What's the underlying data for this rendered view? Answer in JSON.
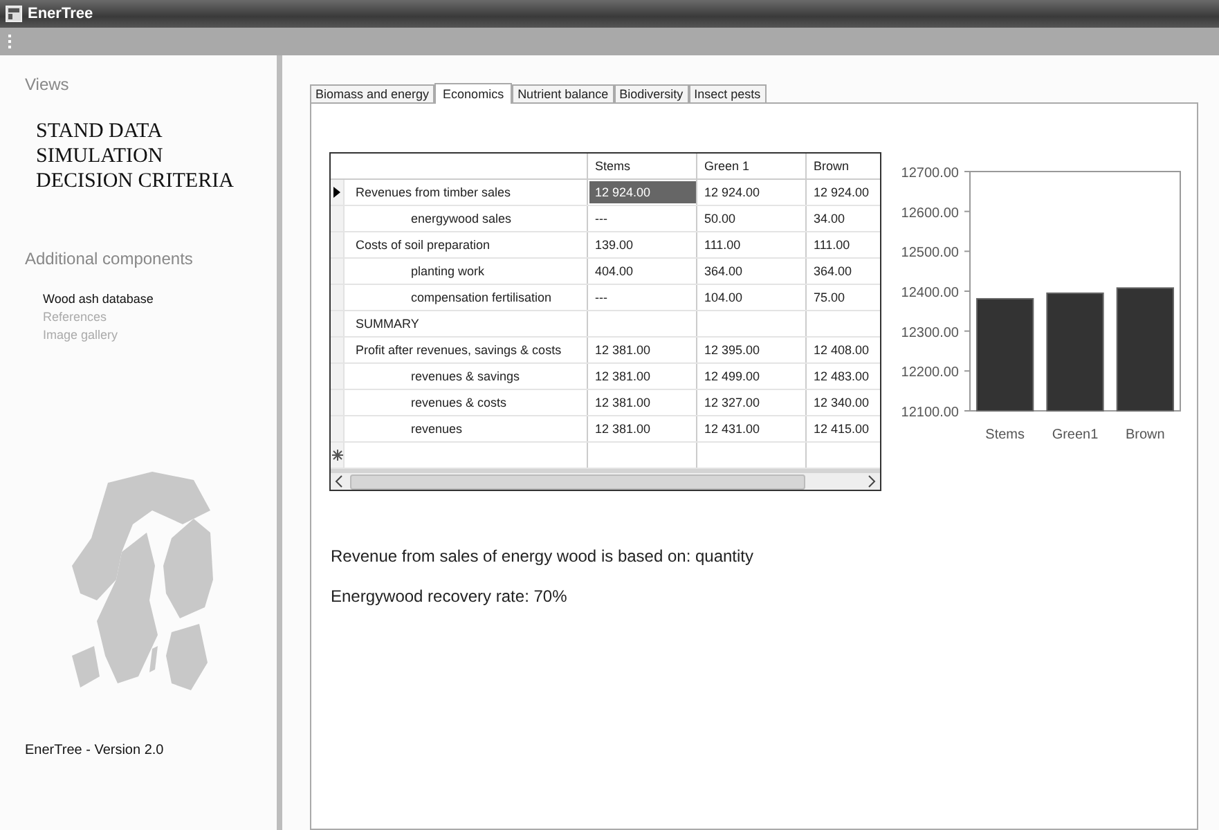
{
  "window": {
    "title": "EnerTree"
  },
  "sidebar": {
    "views_heading": "Views",
    "views": [
      "STAND DATA",
      "SIMULATION",
      "DECISION CRITERIA"
    ],
    "components_heading": "Additional components",
    "components": [
      {
        "label": "Wood ash database",
        "disabled": false
      },
      {
        "label": "References",
        "disabled": true
      },
      {
        "label": "Image gallery",
        "disabled": true
      }
    ],
    "version": "EnerTree - Version 2.0"
  },
  "tabs": [
    {
      "label": "Biomass and energy",
      "selected": false
    },
    {
      "label": "Economics",
      "selected": true
    },
    {
      "label": "Nutrient balance",
      "selected": false
    },
    {
      "label": "Biodiversity",
      "selected": false
    },
    {
      "label": "Insect pests",
      "selected": false
    }
  ],
  "table": {
    "columns": [
      "Stems",
      "Green 1",
      "Brown"
    ],
    "rows": [
      {
        "label": "Revenues from timber sales",
        "current": true,
        "cells": [
          {
            "text": "12 924.00",
            "selected": true
          },
          {
            "text": "12 924.00",
            "selected": false
          },
          {
            "text": "12 924.00",
            "selected": false
          }
        ],
        "children": [
          {
            "label": "energywood sales",
            "current": false,
            "cells": [
              {
                "text": "---",
                "selected": false
              },
              {
                "text": "50.00",
                "selected": false
              },
              {
                "text": "34.00",
                "selected": false
              }
            ]
          }
        ]
      },
      {
        "label": "Costs of soil preparation",
        "current": false,
        "cells": [
          {
            "text": "139.00",
            "selected": false
          },
          {
            "text": "111.00",
            "selected": false
          },
          {
            "text": "111.00",
            "selected": false
          }
        ],
        "children": [
          {
            "label": "planting work",
            "current": false,
            "cells": [
              {
                "text": "404.00",
                "selected": false
              },
              {
                "text": "364.00",
                "selected": false
              },
              {
                "text": "364.00",
                "selected": false
              }
            ]
          },
          {
            "label": "compensation fertilisation",
            "current": false,
            "cells": [
              {
                "text": "---",
                "selected": false
              },
              {
                "text": "104.00",
                "selected": false
              },
              {
                "text": "75.00",
                "selected": false
              }
            ]
          }
        ]
      },
      {
        "label": "SUMMARY",
        "current": false,
        "cells": []
      },
      {
        "label": "Profit after revenues, savings & costs",
        "current": false,
        "cells": [
          {
            "text": "12 381.00",
            "selected": false
          },
          {
            "text": "12 395.00",
            "selected": false
          },
          {
            "text": "12 408.00",
            "selected": false
          }
        ],
        "children": [
          {
            "label": "revenues & savings",
            "current": false,
            "cells": [
              {
                "text": "12 381.00",
                "selected": false
              },
              {
                "text": "12 499.00",
                "selected": false
              },
              {
                "text": "12 483.00",
                "selected": false
              }
            ]
          },
          {
            "label": "revenues & costs",
            "current": false,
            "cells": [
              {
                "text": "12 381.00",
                "selected": false
              },
              {
                "text": "12 327.00",
                "selected": false
              },
              {
                "text": "12 340.00",
                "selected": false
              }
            ]
          },
          {
            "label": "revenues",
            "current": false,
            "cells": [
              {
                "text": "12 381.00",
                "selected": false
              },
              {
                "text": "12 431.00",
                "selected": false
              },
              {
                "text": "12 415.00",
                "selected": false
              }
            ]
          }
        ]
      }
    ]
  },
  "chart": {
    "chart_data": {
      "type": "bar",
      "categories": [
        "Stems",
        "Green1",
        "Brown"
      ],
      "series": [
        {
          "color": "#333333",
          "values": [
            12381,
            12395,
            12408
          ]
        }
      ],
      "ylim": [
        12100,
        12700
      ],
      "yticks": [
        {
          "value": 12100,
          "label": "12100.00"
        },
        {
          "value": 12200,
          "label": "12200.00"
        },
        {
          "value": 12300,
          "label": "12300.00"
        },
        {
          "value": 12400,
          "label": "12400.00"
        },
        {
          "value": 12500,
          "label": "12500.00"
        },
        {
          "value": 12600,
          "label": "12600.00"
        },
        {
          "value": 12700,
          "label": "12700.00"
        }
      ]
    }
  },
  "notes": [
    "Revenue from sales of energy wood is based on: quantity",
    "Energywood recovery rate: 70%"
  ]
}
